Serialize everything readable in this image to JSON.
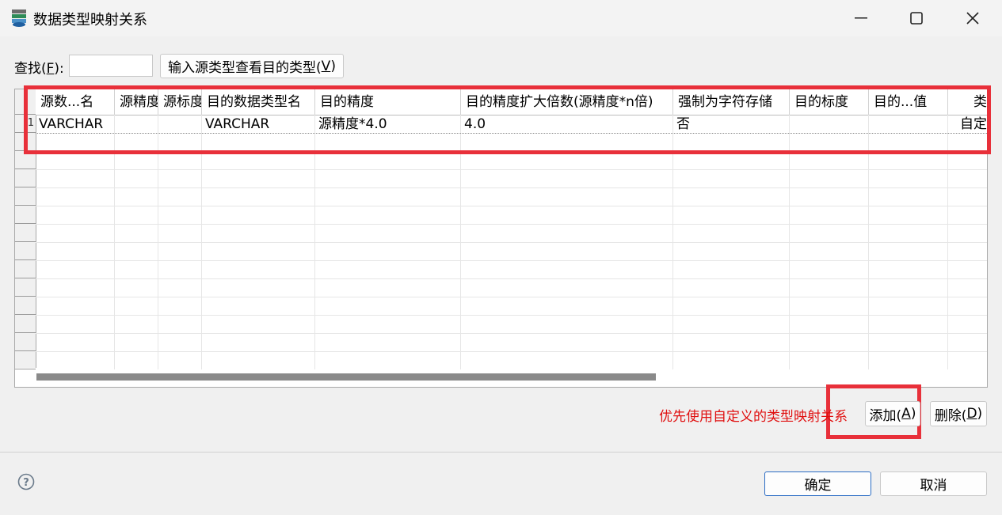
{
  "window": {
    "title": "数据类型映射关系",
    "icon": "database-stack-icon"
  },
  "search": {
    "label_prefix": "查找(",
    "label_key": "F",
    "label_suffix": "):",
    "value": "",
    "lookup_button": "输入源类型查看目的类型(",
    "lookup_key": "V",
    "lookup_suffix": ")"
  },
  "table": {
    "columns": [
      "源数...名",
      "源精度",
      "源标度",
      "目的数据类型名",
      "目的精度",
      "目的精度扩大倍数(源精度*n倍)",
      "强制为字符存储",
      "目的标度",
      "目的...值",
      "类"
    ],
    "rows": [
      [
        "VARCHAR",
        "",
        "",
        "VARCHAR",
        "源精度*4.0",
        "4.0",
        "否",
        "",
        "",
        "自定"
      ]
    ],
    "row_handle_first": "1"
  },
  "footer": {
    "priority_note": "优先使用自定义的类型映射关系",
    "add_label": "添加(",
    "add_key": "A",
    "add_suffix": ")",
    "delete_label": "删除(",
    "delete_key": "D",
    "delete_suffix": ")",
    "ok_label": "确定",
    "cancel_label": "取消"
  },
  "colors": {
    "highlight_box": "#e8303a",
    "priority_note": "#e01010",
    "ok_border": "#2b6cc4"
  }
}
